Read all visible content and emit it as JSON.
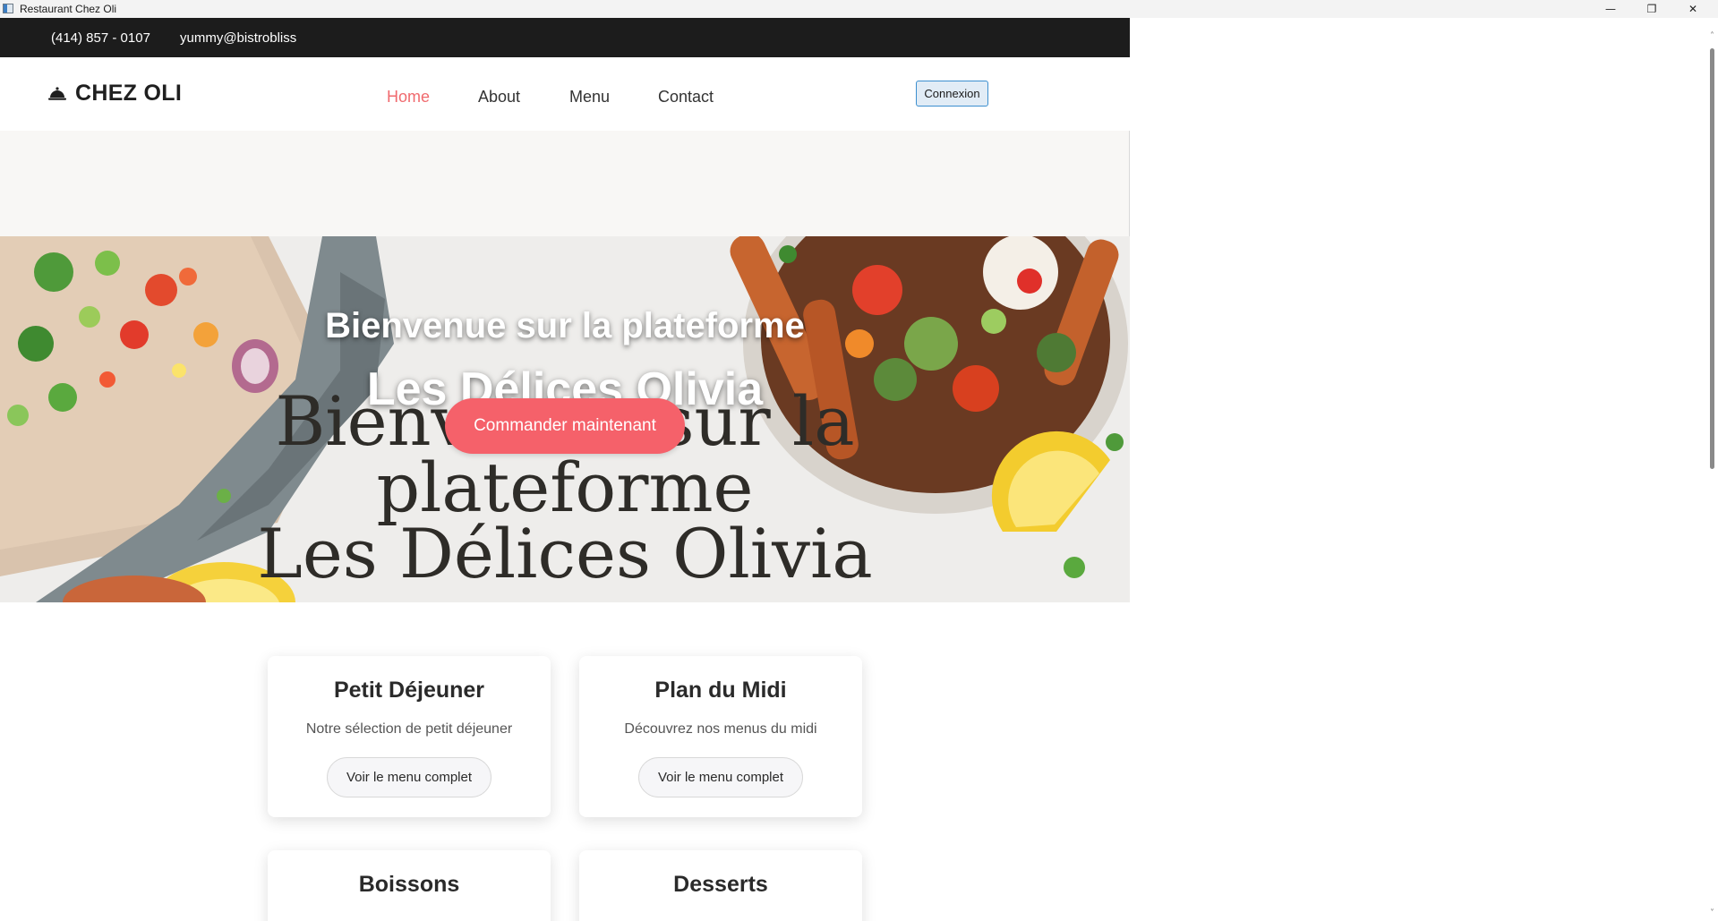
{
  "window": {
    "title": "Restaurant Chez Oli",
    "minimize_glyph": "—",
    "maximize_glyph": "❐",
    "close_glyph": "✕"
  },
  "topbar": {
    "phone": "(414) 857 - 0107",
    "email": "yummy@bistrobliss"
  },
  "header": {
    "brand_icon": "cloche-icon",
    "brand_name": "CHEZ OLI",
    "nav": [
      {
        "label": "Home",
        "active": true
      },
      {
        "label": "About",
        "active": false
      },
      {
        "label": "Menu",
        "active": false
      },
      {
        "label": "Contact",
        "active": false
      }
    ],
    "login_label": "Connexion"
  },
  "hero": {
    "line1": "Bienvenue sur la plateforme",
    "line2": "Les Délices Olivia",
    "big_text": [
      "Bienvenue sur la",
      "plateforme",
      "Les Délices Olivia"
    ],
    "cta_label": "Commander maintenant"
  },
  "cards": [
    {
      "title": "Petit Déjeuner",
      "description": "Notre sélection de petit déjeuner",
      "button": "Voir le menu complet"
    },
    {
      "title": "Plan du Midi",
      "description": "Découvrez nos menus du midi",
      "button": "Voir le menu complet"
    },
    {
      "title": "Boissons",
      "description": "",
      "button": ""
    },
    {
      "title": "Desserts",
      "description": "",
      "button": ""
    }
  ],
  "colors": {
    "accent": "#f5616a",
    "nav_active": "#f06a6e",
    "topbar_bg": "#1c1c1c",
    "login_border": "#3c8fcf"
  }
}
